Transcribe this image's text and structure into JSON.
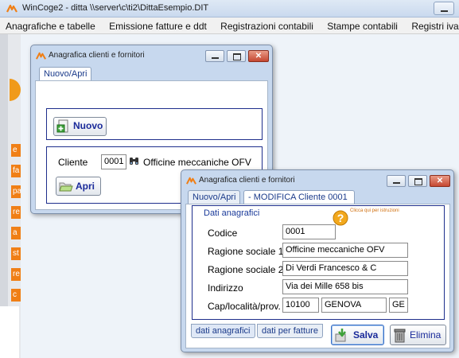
{
  "app": {
    "title": "WinCoge2 - ditta \\\\server\\c\\ti2\\DittaEsempio.DIT"
  },
  "menu": [
    "Anagrafiche e tabelle",
    "Emissione fatture e ddt",
    "Registrazioni contabili",
    "Stampe contabili",
    "Registri iva e giornale"
  ],
  "side_tabs": [
    "e",
    "fa",
    "pa",
    "re",
    "a",
    "st",
    "re",
    "c"
  ],
  "dialog_back": {
    "title": "Anagrafica clienti e fornitori",
    "tab": "Nuovo/Apri",
    "new_button": "Nuovo",
    "cliente_label": "Cliente",
    "cliente_code": "0001",
    "cliente_name": "Officine meccaniche OFV",
    "open_button": "Apri"
  },
  "dialog_front": {
    "title": "Anagrafica clienti e fornitori",
    "tabs": [
      "Nuovo/Apri",
      "- MODIFICA Cliente 0001"
    ],
    "section_title": "Dati anagrafici",
    "help_text": "Clicca qui per istruzioni",
    "fields": {
      "codice": {
        "label": "Codice",
        "value": "0001"
      },
      "ragione1": {
        "label": "Ragione sociale 1",
        "value": "Officine meccaniche OFV"
      },
      "ragione2": {
        "label": "Ragione sociale 2",
        "value": "Di Verdi Francesco & C"
      },
      "indirizzo": {
        "label": "Indirizzo",
        "value": "Via dei Mille 658 bis"
      },
      "cap": {
        "label": "Cap/località/prov.",
        "cap": "10100",
        "localita": "GENOVA",
        "prov": "GE"
      }
    },
    "bottom_tabs": [
      "dati anagrafici",
      "dati per fatture"
    ],
    "save_button": "Salva",
    "delete_button": "Elimina"
  },
  "colors": {
    "accent_orange": "#f07f16",
    "dialog_frame": "#c7d8ee",
    "group_border": "#1e2e8c"
  }
}
